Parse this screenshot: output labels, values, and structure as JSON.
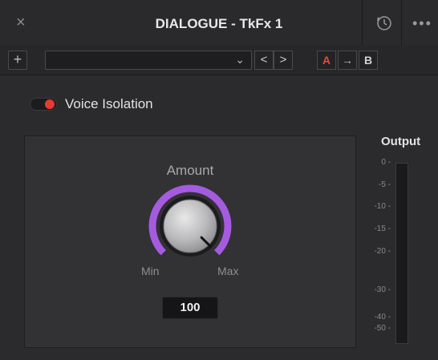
{
  "window": {
    "title": "DIALOGUE - TkFx 1",
    "close_glyph": "×",
    "more_glyph": "•••",
    "reset_icon": "reset-clock-icon"
  },
  "toolbar": {
    "add_glyph": "+",
    "preset_value": "",
    "preset_chevron": "⌄",
    "prev_glyph": "<",
    "next_glyph": ">",
    "a_label": "A",
    "arrow_glyph": "→",
    "b_label": "B"
  },
  "voice_isolation": {
    "label": "Voice Isolation",
    "enabled": true,
    "color": "#e53c2d"
  },
  "amount": {
    "label": "Amount",
    "min_label": "Min",
    "max_label": "Max",
    "value": "100",
    "fraction": 1.0,
    "accent": "#a55be0"
  },
  "output": {
    "label": "Output",
    "ticks": [
      "0 -",
      "-5 -",
      "-10 -",
      "-15 -",
      "-20 -",
      "-30 -",
      "-40 -",
      "-50 -"
    ],
    "level": 0
  }
}
